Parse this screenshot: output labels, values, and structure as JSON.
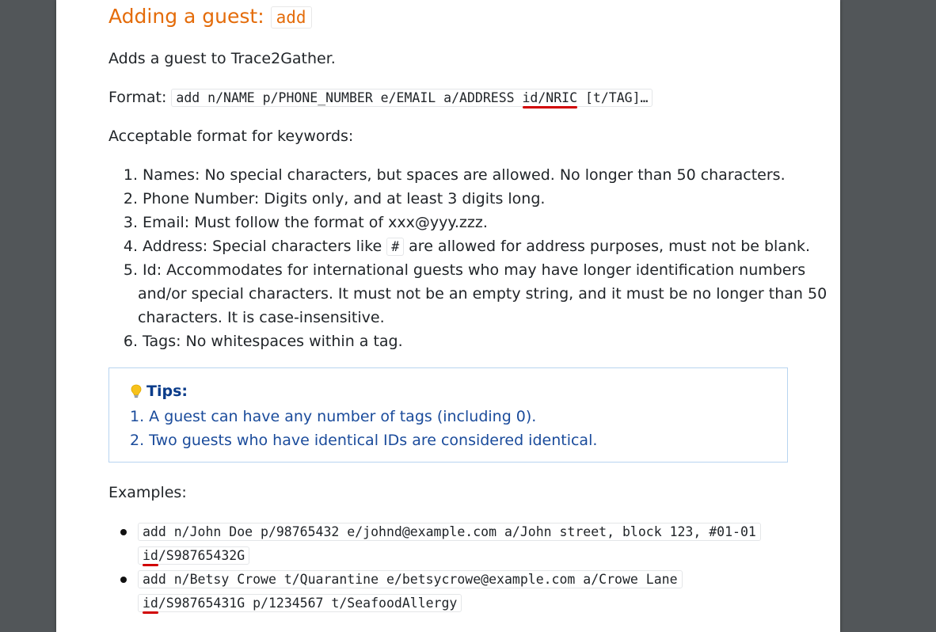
{
  "section": {
    "heading_text": "Adding a guest: ",
    "heading_code": "add",
    "description": "Adds a guest to Trace2Gather."
  },
  "format": {
    "label": "Format: ",
    "cmd_before": "add n/NAME p/PHONE_NUMBER e/EMAIL a/ADDRESS ",
    "cmd_highlight": "id/NRIC",
    "cmd_after": " [t/TAG]…"
  },
  "keywords": {
    "intro": "Acceptable format for keywords:",
    "items": [
      {
        "num": "1.",
        "text": "Names: No special characters, but spaces are allowed. No longer than 50 characters."
      },
      {
        "num": "2.",
        "text": "Phone Number: Digits only, and at least 3 digits long."
      },
      {
        "num": "3.",
        "text": "Email: Must follow the format of xxx@yyy.zzz."
      },
      {
        "num": "4.",
        "text_before": "Address: Special characters like ",
        "code": "#",
        "text_after": " are allowed for address purposes, must not be blank."
      },
      {
        "num": "5.",
        "lines": [
          "Id: Accommodates for international guests who may have longer identification numbers",
          "and/or special characters. It must not be an empty string, and it must be no longer than 50",
          "characters. It is case-insensitive."
        ]
      },
      {
        "num": "6.",
        "text": "Tags: No whitespaces within a tag."
      }
    ]
  },
  "tips": {
    "title": "Tips:",
    "icon": "lightbulb-icon",
    "items": [
      "1. A guest can have any number of tags (including 0).",
      "2. Two guests who have identical IDs are considered identical."
    ]
  },
  "examples": {
    "label": "Examples:",
    "items": [
      {
        "line1": "add n/John Doe p/98765432 e/johnd@example.com a/John street, block 123, #01-01",
        "id_prefix": "id",
        "line2_rest": "/S98765432G"
      },
      {
        "line1": "add n/Betsy Crowe t/Quarantine e/betsycrowe@example.com a/Crowe Lane",
        "id_prefix": "id",
        "line2_rest": "/S98765431G p/1234567 t/SeafoodAllergy"
      }
    ]
  },
  "colors": {
    "heading": "#e46c0a",
    "tips_text": "#1a4b9b",
    "tips_border": "#b8d4f0",
    "highlight_underline": "#d10000",
    "viewer_background": "#525659"
  }
}
